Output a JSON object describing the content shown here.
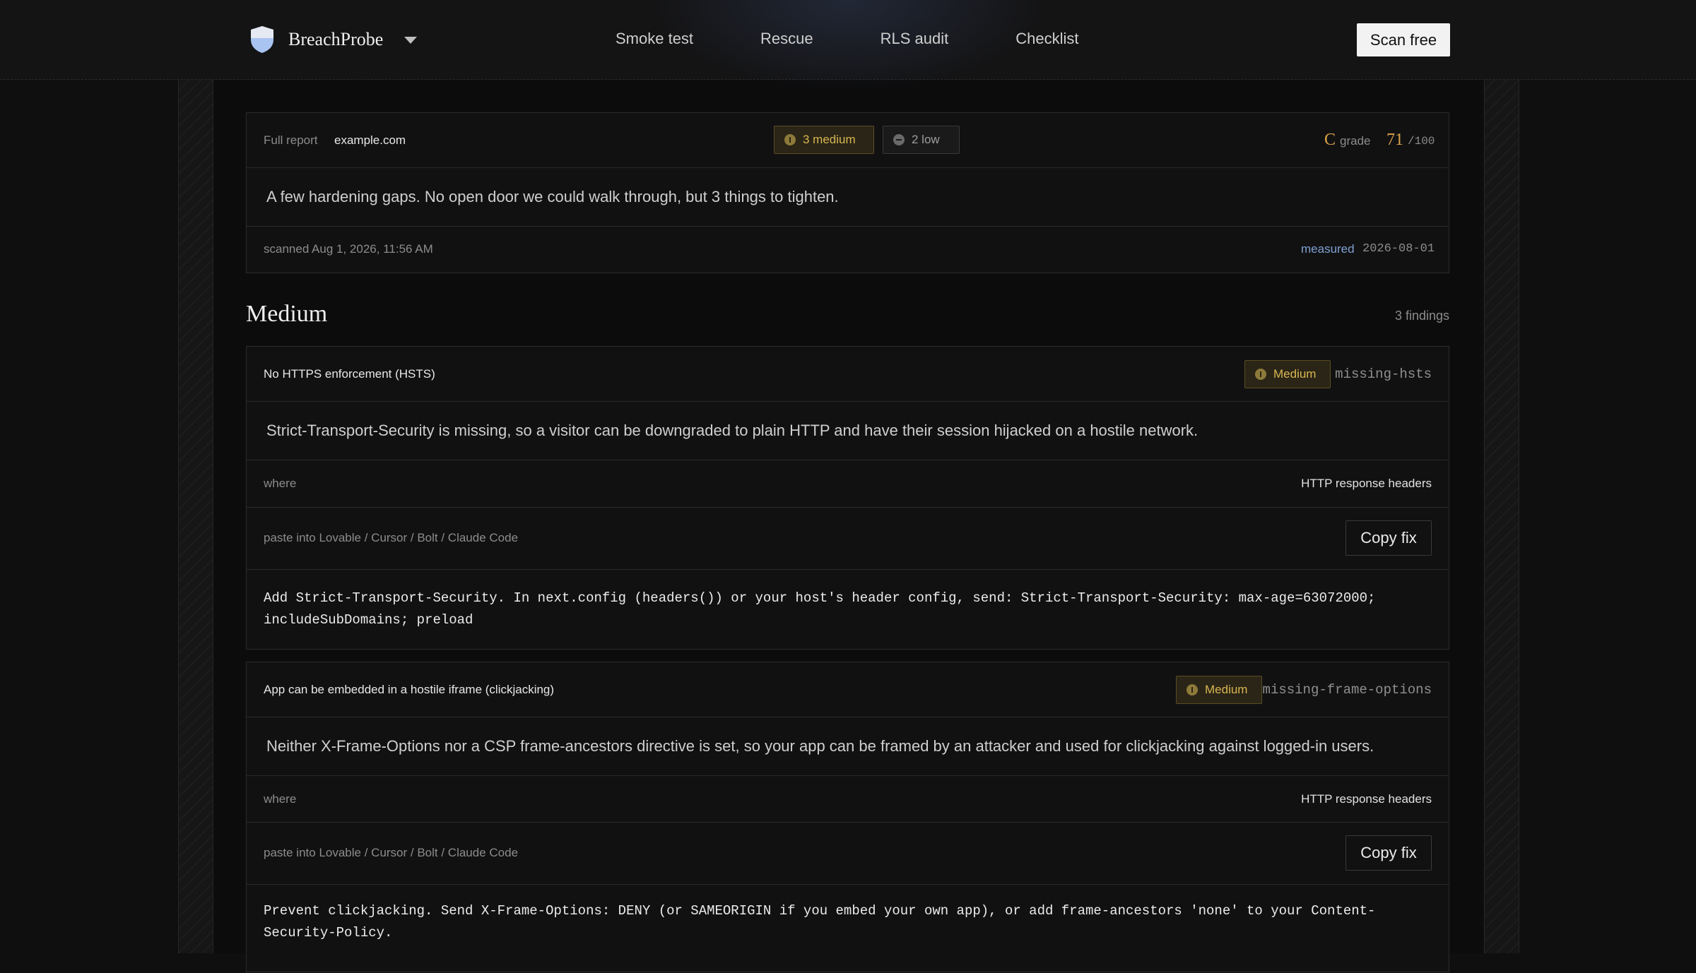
{
  "header": {
    "brand": "BreachProbe",
    "nav": [
      "Smoke test",
      "Rescue",
      "RLS audit",
      "Checklist"
    ],
    "scan_label": "Scan free"
  },
  "summary": {
    "full_report_label": "Full report",
    "domain": "example.com",
    "medium_pill": "3 medium",
    "low_pill": "2 low",
    "grade_letter": "C",
    "grade_label": "grade",
    "score": "71",
    "score_max": "/100",
    "message": "A few hardening gaps. No open door we could walk through, but 3 things to tighten.",
    "scanned": "scanned Aug 1, 2026, 11:56 AM",
    "measured_label": "measured",
    "measured_date": "2026-08-01"
  },
  "section": {
    "title": "Medium",
    "count": "3 findings"
  },
  "findings": [
    {
      "title": "No HTTPS enforcement (HSTS)",
      "severity": "Medium",
      "slug": "missing-hsts",
      "description": "Strict-Transport-Security is missing, so a visitor can be downgraded to plain HTTP and have their session hijacked on a hostile network.",
      "where_label": "where",
      "where_value": "HTTP response headers",
      "paste_label": "paste into Lovable / Cursor / Bolt / Claude Code",
      "copy_label": "Copy fix",
      "fix_line1": "Add Strict-Transport-Security. In next.config (headers()) or your host's header config, send: Strict-Transport-Security: max-age=63072000;",
      "fix_line2": "includeSubDomains; preload"
    },
    {
      "title": "App can be embedded in a hostile iframe (clickjacking)",
      "severity": "Medium",
      "slug": "missing-frame-options",
      "description": "Neither X-Frame-Options nor a CSP frame-ancestors directive is set, so your app can be framed by an attacker and used for clickjacking against logged-in users.",
      "where_label": "where",
      "where_value": "HTTP response headers",
      "paste_label": "paste into Lovable / Cursor / Bolt / Claude Code",
      "copy_label": "Copy fix",
      "fix_line1": "Prevent clickjacking. Send X-Frame-Options: DENY (or SAMEORIGIN if you embed your own app), or add frame-ancestors 'none' to your Content-",
      "fix_line2": "Security-Policy."
    }
  ]
}
